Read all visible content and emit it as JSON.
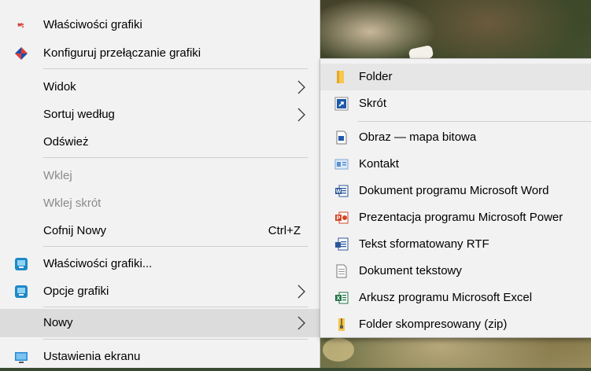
{
  "menu": {
    "items": [
      {
        "label": "Właściwości grafiki",
        "icon": "intel-graphics-icon"
      },
      {
        "label": "Konfiguruj przełączanie grafiki",
        "icon": "amd-graphics-icon"
      },
      {
        "label": "Widok",
        "submenu": true
      },
      {
        "label": "Sortuj według",
        "submenu": true
      },
      {
        "label": "Odśwież"
      },
      {
        "label": "Wklej",
        "disabled": true
      },
      {
        "label": "Wklej skrót",
        "disabled": true
      },
      {
        "label": "Cofnij Nowy",
        "shortcut": "Ctrl+Z"
      },
      {
        "label": "Właściwości grafiki...",
        "icon": "graphics-monitor-icon"
      },
      {
        "label": "Opcje grafiki",
        "icon": "graphics-monitor-icon",
        "submenu": true
      },
      {
        "label": "Nowy",
        "submenu": true,
        "selected": true
      },
      {
        "label": "Ustawienia ekranu",
        "icon": "display-icon"
      }
    ]
  },
  "submenu": {
    "items": [
      {
        "label": "Folder",
        "icon": "folder-icon",
        "selected": true
      },
      {
        "label": "Skrót",
        "icon": "shortcut-icon"
      },
      {
        "label": "Obraz — mapa bitowa",
        "icon": "bitmap-icon"
      },
      {
        "label": "Kontakt",
        "icon": "contact-icon"
      },
      {
        "label": "Dokument programu Microsoft Word",
        "icon": "word-icon"
      },
      {
        "label": "Prezentacja programu Microsoft Power",
        "icon": "powerpoint-icon"
      },
      {
        "label": "Tekst sformatowany RTF",
        "icon": "rtf-icon"
      },
      {
        "label": "Dokument tekstowy",
        "icon": "text-document-icon"
      },
      {
        "label": "Arkusz programu Microsoft Excel",
        "icon": "excel-icon"
      },
      {
        "label": "Folder skompresowany (zip)",
        "icon": "zip-folder-icon"
      }
    ]
  },
  "colors": {
    "menu_bg": "#f2f2f2",
    "selected_bg": "#dcdcdc",
    "disabled_text": "#8a8a8a",
    "word_blue": "#2b579a",
    "powerpoint_red": "#d24726",
    "excel_green": "#217346",
    "folder_yellow": "#f8c74b"
  }
}
